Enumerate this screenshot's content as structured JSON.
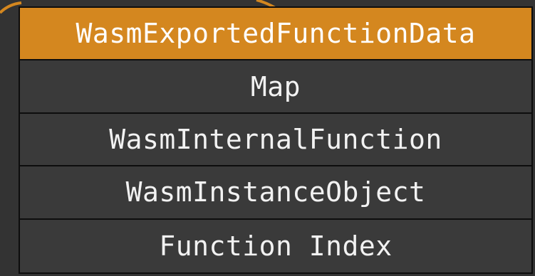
{
  "struct": {
    "rows": [
      {
        "label": "WasmExportedFunctionData",
        "highlighted": true
      },
      {
        "label": "Map",
        "highlighted": false
      },
      {
        "label": "WasmInternalFunction",
        "highlighted": false
      },
      {
        "label": "WasmInstanceObject",
        "highlighted": false
      },
      {
        "label": "Function Index",
        "highlighted": false
      }
    ]
  },
  "colors": {
    "background": "#333333",
    "highlight": "#d4871f",
    "border": "#0d0d0d",
    "text": "#f2f2f2"
  }
}
